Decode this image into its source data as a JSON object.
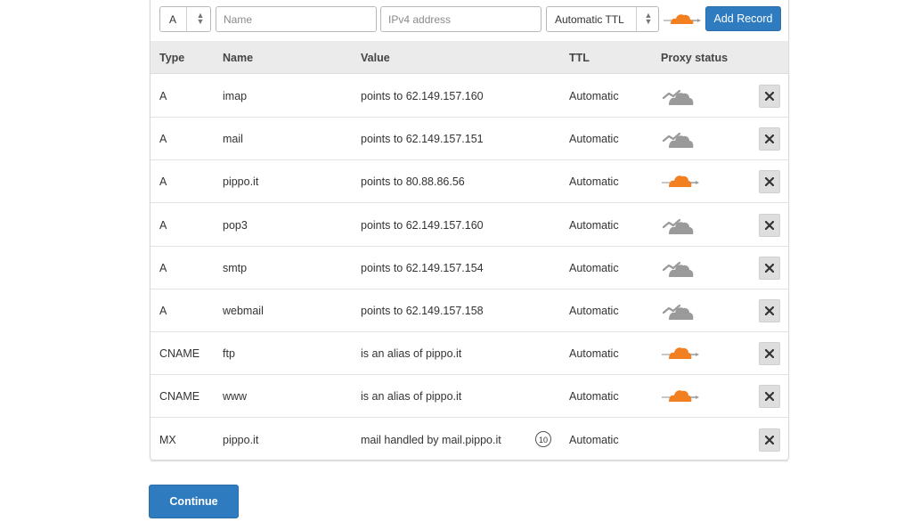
{
  "add_record": {
    "type_value": "A",
    "name_placeholder": "Name",
    "ip_placeholder": "IPv4 address",
    "ttl_value": "Automatic TTL",
    "proxy_icon": "cloud-proxied-icon",
    "add_label": "Add Record"
  },
  "columns": {
    "type": "Type",
    "name": "Name",
    "value": "Value",
    "ttl": "TTL",
    "proxy": "Proxy status"
  },
  "records": [
    {
      "type": "A",
      "name": "imap",
      "value": "points to 62.149.157.160",
      "ttl": "Automatic",
      "proxy": "dns-only"
    },
    {
      "type": "A",
      "name": "mail",
      "value": "points to 62.149.157.151",
      "ttl": "Automatic",
      "proxy": "dns-only"
    },
    {
      "type": "A",
      "name": "pippo.it",
      "value": "points to 80.88.86.56",
      "ttl": "Automatic",
      "proxy": "proxied"
    },
    {
      "type": "A",
      "name": "pop3",
      "value": "points to 62.149.157.160",
      "ttl": "Automatic",
      "proxy": "dns-only"
    },
    {
      "type": "A",
      "name": "smtp",
      "value": "points to 62.149.157.154",
      "ttl": "Automatic",
      "proxy": "dns-only"
    },
    {
      "type": "A",
      "name": "webmail",
      "value": "points to 62.149.157.158",
      "ttl": "Automatic",
      "proxy": "dns-only"
    },
    {
      "type": "CNAME",
      "name": "ftp",
      "value": "is an alias of pippo.it",
      "ttl": "Automatic",
      "proxy": "proxied"
    },
    {
      "type": "CNAME",
      "name": "www",
      "value": "is an alias of pippo.it",
      "ttl": "Automatic",
      "proxy": "proxied"
    },
    {
      "type": "MX",
      "name": "pippo.it",
      "value": "mail handled by mail.pippo.it",
      "priority": "10",
      "ttl": "Automatic",
      "proxy": ""
    }
  ],
  "continue_label": "Continue",
  "colors": {
    "accent": "#2f7bbf",
    "proxied": "#f38020",
    "dns_only": "#9a9a9a",
    "header_bg": "#ebebeb"
  }
}
